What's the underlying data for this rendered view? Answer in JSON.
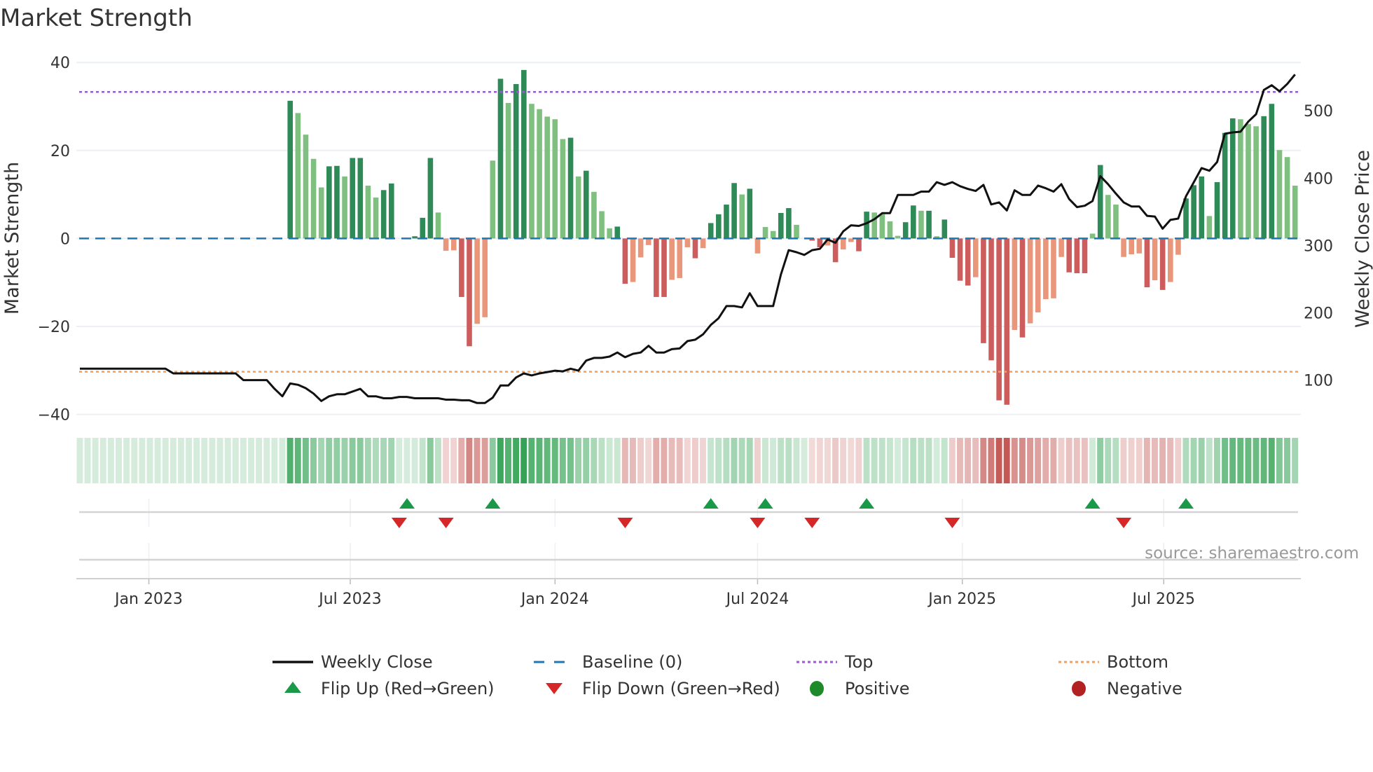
{
  "title": "Market Strength",
  "source": "source: sharemaestro.com",
  "colors": {
    "pos_strong": "#2e8b57",
    "pos_weak": "#7fbf7f",
    "neg_strong": "#cd5c5c",
    "neg_weak": "#e9967a",
    "baseline": "#1f77b4",
    "top": "#9b59d9",
    "bottom": "#f0a060",
    "close": "#111111",
    "flip_up": "#1a9a48",
    "flip_down": "#d62728",
    "positive": "#1f8a2a",
    "negative": "#b22222"
  },
  "chart_data": {
    "type": "bar",
    "title": "Market Strength",
    "start_week": "2022-10-31",
    "frequency": "weekly",
    "ylabel": "Market Strength",
    "y2label": "Weekly Close Price",
    "ylim": [
      -40,
      40
    ],
    "y2lim": [
      30,
      560
    ],
    "yticks": [
      "40",
      "20",
      "0",
      "−20",
      "−40"
    ],
    "ytick_values": [
      40,
      20,
      0,
      -20,
      -40
    ],
    "y2ticks": [
      "500",
      "400",
      "300",
      "200",
      "100"
    ],
    "y2tick_values": [
      500,
      400,
      300,
      200,
      100
    ],
    "xticks": [
      {
        "label": "Jan 2023",
        "date": "2023-01-01"
      },
      {
        "label": "Jul 2023",
        "date": "2023-07-01"
      },
      {
        "label": "Jan 2024",
        "date": "2024-01-01"
      },
      {
        "label": "Jul 2024",
        "date": "2024-07-01"
      },
      {
        "label": "Jan 2025",
        "date": "2025-01-01"
      },
      {
        "label": "Jul 2025",
        "date": "2025-07-01"
      }
    ],
    "top_level": 33.3,
    "bottom_level": -30.3,
    "baseline": 0,
    "strength": [
      0,
      0,
      0,
      0,
      0,
      0,
      0,
      0,
      0,
      0,
      0,
      0,
      0,
      0,
      0,
      0,
      0,
      0,
      0,
      0,
      0,
      0,
      0,
      0,
      0,
      0,
      0,
      31.3,
      28.5,
      23.6,
      18.1,
      11.6,
      16.4,
      16.5,
      14.1,
      18.3,
      18.3,
      12.0,
      9.3,
      11.0,
      12.5,
      0,
      0,
      0.5,
      4.7,
      18.3,
      5.9,
      -2.8,
      -2.7,
      -13.3,
      -24.5,
      -19.4,
      -17.9,
      17.7,
      36.3,
      30.8,
      35.1,
      38.3,
      30.6,
      29.4,
      27.7,
      27.1,
      22.6,
      22.9,
      14.1,
      15.4,
      10.6,
      6.2,
      2.3,
      2.7,
      -10.3,
      -9.9,
      -4.3,
      -1.5,
      -13.3,
      -13.3,
      -9.4,
      -9.0,
      -2.0,
      -4.5,
      -2.2,
      3.5,
      5.5,
      7.7,
      12.6,
      10.0,
      11.3,
      -3.4,
      2.6,
      1.7,
      5.8,
      6.9,
      3.1,
      0,
      -0.5,
      -2.0,
      -1.6,
      -5.4,
      -2.5,
      -0.8,
      -2.9,
      6.1,
      5.9,
      5.5,
      3.9,
      0.6,
      3.7,
      7.5,
      6.3,
      6.3,
      0.5,
      4.3,
      -4.4,
      -9.6,
      -10.7,
      -8.8,
      -23.8,
      -27.7,
      -36.8,
      -37.8,
      -20.8,
      -22.5,
      -19.3,
      -16.8,
      -13.8,
      -13.6,
      -4.2,
      -7.7,
      -7.9,
      -7.9,
      1.1,
      16.7,
      9.9,
      7.7,
      -4.2,
      -3.6,
      -3.4,
      -11.1,
      -9.5,
      -11.7,
      -9.9,
      -3.7,
      9.1,
      12.1,
      14.1,
      5.1,
      12.8,
      24.0,
      27.3,
      27.1,
      26.0,
      25.5,
      27.8,
      30.6,
      20.1,
      18.5,
      12.0
    ],
    "weekly_close": [
      117,
      117,
      117,
      117,
      117,
      117,
      117,
      117,
      117,
      117,
      117,
      117,
      110,
      110,
      110,
      110,
      110,
      110,
      110,
      110,
      110,
      100,
      100,
      100,
      100,
      87,
      76,
      95,
      93,
      88,
      80,
      69,
      76,
      79,
      79,
      83,
      87,
      76,
      76,
      73,
      73,
      75,
      75,
      73,
      73,
      73,
      73,
      71,
      71,
      70,
      70,
      66,
      66,
      74,
      92,
      92,
      104,
      110,
      107,
      110,
      112,
      114,
      113,
      117,
      114,
      129,
      133,
      133,
      135,
      141,
      134,
      139,
      141,
      151,
      141,
      141,
      146,
      147,
      158,
      160,
      168,
      182,
      192,
      210,
      210,
      208,
      229,
      210,
      210,
      210,
      257,
      293,
      290,
      286,
      293,
      295,
      309,
      304,
      321,
      330,
      329,
      333,
      339,
      348,
      348,
      375,
      375,
      375,
      380,
      380,
      394,
      390,
      394,
      388,
      384,
      381,
      390,
      361,
      364,
      352,
      382,
      375,
      375,
      389,
      385,
      380,
      391,
      369,
      357,
      359,
      366,
      403,
      391,
      377,
      364,
      358,
      358,
      344,
      343,
      325,
      338,
      340,
      373,
      394,
      415,
      411,
      424,
      466,
      468,
      469,
      484,
      495,
      531,
      538,
      529,
      540,
      554
    ],
    "flip_up_weeks": [
      42,
      53,
      81,
      88,
      101,
      130,
      142
    ],
    "flip_down_weeks": [
      41,
      47,
      70,
      87,
      94,
      112,
      134
    ],
    "legend": {
      "placement": "bottom",
      "items": [
        {
          "label": "Weekly Close",
          "symbol": "line"
        },
        {
          "label": "Baseline (0)",
          "symbol": "dash"
        },
        {
          "label": "Top",
          "symbol": "dot"
        },
        {
          "label": "Bottom",
          "symbol": "dot"
        },
        {
          "label": "Flip Up (Red→Green)",
          "symbol": "triangle-up"
        },
        {
          "label": "Flip Down (Green→Red)",
          "symbol": "triangle-down"
        },
        {
          "label": "Positive",
          "symbol": "circle"
        },
        {
          "label": "Negative",
          "symbol": "circle"
        }
      ]
    }
  }
}
